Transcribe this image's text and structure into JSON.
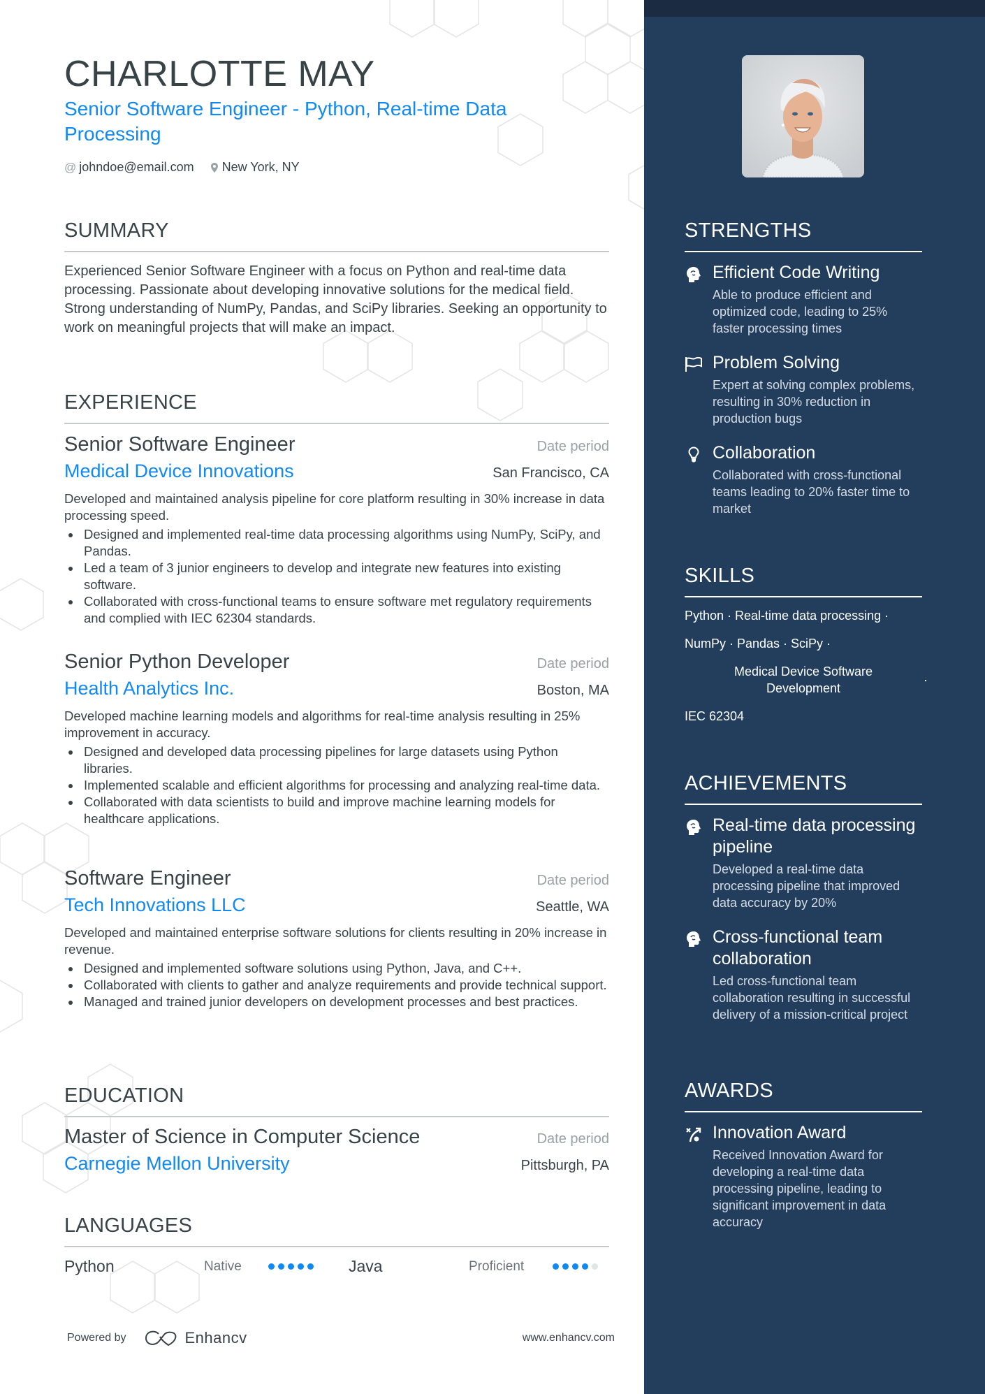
{
  "header": {
    "name": "CHARLOTTE MAY",
    "headline": "Senior Software Engineer - Python, Real-time Data Processing",
    "email": "johndoe@email.com",
    "location": "New York, NY"
  },
  "summary": {
    "title": "SUMMARY",
    "text": "Experienced Senior Software Engineer with a focus on Python and real-time data processing. Passionate about developing innovative solutions for the medical field. Strong understanding of NumPy, Pandas, and SciPy libraries. Seeking an opportunity to work on meaningful projects that will make an impact."
  },
  "experience": {
    "title": "EXPERIENCE",
    "jobs": [
      {
        "title": "Senior Software Engineer",
        "date": "Date period",
        "company": "Medical Device Innovations",
        "location": "San Francisco, CA",
        "description": "Developed and maintained analysis pipeline for core platform resulting in 30% increase in data processing speed.",
        "bullets": [
          "Designed and implemented real-time data processing algorithms using NumPy, SciPy, and Pandas.",
          "Led a team of 3 junior engineers to develop and integrate new features into existing software.",
          "Collaborated with cross-functional teams to ensure software met regulatory requirements and complied with IEC 62304 standards."
        ]
      },
      {
        "title": "Senior Python Developer",
        "date": "Date period",
        "company": "Health Analytics Inc.",
        "location": "Boston, MA",
        "description": "Developed machine learning models and algorithms for real-time analysis resulting in 25% improvement in accuracy.",
        "bullets": [
          "Designed and developed data processing pipelines for large datasets using Python libraries.",
          "Implemented scalable and efficient algorithms for processing and analyzing real-time data.",
          "Collaborated with data scientists to build and improve machine learning models for healthcare applications."
        ]
      },
      {
        "title": "Software Engineer",
        "date": "Date period",
        "company": "Tech Innovations LLC",
        "location": "Seattle, WA",
        "description": "Developed and maintained enterprise software solutions for clients resulting in 20% increase in revenue.",
        "bullets": [
          "Designed and implemented software solutions using Python, Java, and C++.",
          "Collaborated with clients to gather and analyze requirements and provide technical support.",
          "Managed and trained junior developers on development processes and best practices."
        ]
      }
    ]
  },
  "education": {
    "title": "EDUCATION",
    "degree": "Master of Science in Computer Science",
    "date": "Date period",
    "school": "Carnegie Mellon University",
    "location": "Pittsburgh, PA"
  },
  "languages": {
    "title": "LANGUAGES",
    "items": [
      {
        "name": "Python",
        "level": "Native",
        "rating": 5,
        "max": 5
      },
      {
        "name": "Java",
        "level": "Proficient",
        "rating": 4,
        "max": 5
      }
    ]
  },
  "footer": {
    "powered_by": "Powered by",
    "brand": "Enhancv",
    "website": "www.enhancv.com"
  },
  "sidebar": {
    "photo_alt": "Profile photo",
    "strengths": {
      "title": "STRENGTHS",
      "items": [
        {
          "icon": "brain-icon",
          "title": "Efficient Code Writing",
          "desc": "Able to produce efficient and optimized code, leading to 25% faster processing times"
        },
        {
          "icon": "flag-icon",
          "title": "Problem Solving",
          "desc": "Expert at solving complex problems, resulting in 30% reduction in production bugs"
        },
        {
          "icon": "lightbulb-icon",
          "title": "Collaboration",
          "desc": "Collaborated with cross-functional teams leading to 20% faster time to market"
        }
      ]
    },
    "skills": {
      "title": "SKILLS",
      "line1": "Python · Real-time data processing ·",
      "line2": "NumPy · Pandas · SciPy ·",
      "line3": "Medical Device Software Development",
      "line3_sep": "·",
      "line4": "IEC 62304"
    },
    "achievements": {
      "title": "ACHIEVEMENTS",
      "items": [
        {
          "icon": "brain-icon",
          "title": "Real-time data processing pipeline",
          "desc": "Developed a real-time data processing pipeline that improved data accuracy by 20%"
        },
        {
          "icon": "brain-icon",
          "title": "Cross-functional team collaboration",
          "desc": "Led cross-functional team collaboration resulting in successful delivery of a mission-critical project"
        }
      ]
    },
    "awards": {
      "title": "AWARDS",
      "items": [
        {
          "icon": "strategy-icon",
          "title": "Innovation Award",
          "desc": "Received Innovation Award for developing a real-time data processing pipeline, leading to significant improvement in data accuracy"
        }
      ]
    }
  },
  "colors": {
    "accent": "#1189f2",
    "sidebar_bg": "#223e5c",
    "sidebar_topbar": "#1b2c42",
    "text": "#384347"
  }
}
